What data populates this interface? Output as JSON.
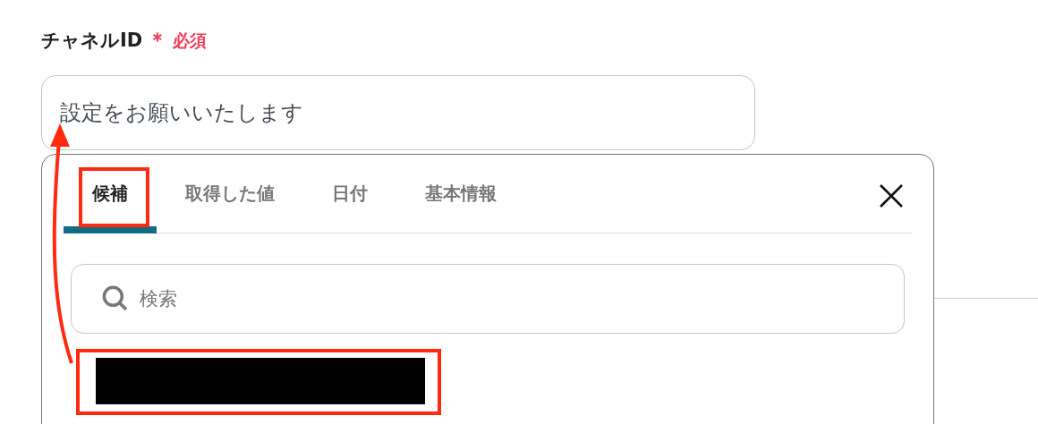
{
  "field": {
    "label": "チャネルID",
    "required_mark": "＊",
    "required_text": "必須",
    "placeholder": "設定をお願いいたします"
  },
  "tabs": [
    {
      "label": "候補",
      "selected": true
    },
    {
      "label": "取得した値",
      "selected": false
    },
    {
      "label": "日付",
      "selected": false
    },
    {
      "label": "基本情報",
      "selected": false
    }
  ],
  "search": {
    "placeholder": "検索"
  },
  "options": [
    {
      "kind": "redacted"
    }
  ]
}
